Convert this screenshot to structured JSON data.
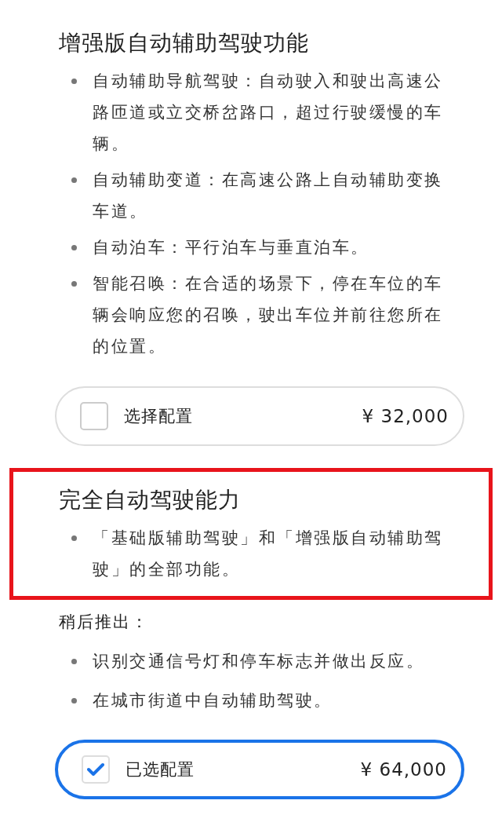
{
  "sections": [
    {
      "title": "增强版自动辅助驾驶功能",
      "highlighted": false,
      "bullets": [
        "自动辅助导航驾驶：自动驶入和驶出高速公路匝道或立交桥岔路口，超过行驶缓慢的车辆。",
        "自动辅助变道：在高速公路上自动辅助变换车道。",
        "自动泊车：平行泊车与垂直泊车。",
        "智能召唤：在合适的场景下，停在车位的车辆会响应您的召唤，驶出车位并前往您所在的位置。"
      ],
      "option": {
        "label": "选择配置",
        "price": "¥ 32,000",
        "selected": false
      }
    },
    {
      "title": "完全自动驾驶能力",
      "highlighted": true,
      "bullets": [
        "「基础版辅助驾驶」和「增强版自动辅助驾驶」的全部功能。"
      ],
      "later_label": "稍后推出：",
      "later_bullets": [
        "识别交通信号灯和停车标志并做出反应。",
        "在城市街道中自动辅助驾驶。"
      ],
      "option": {
        "label": "已选配置",
        "price": "¥ 64,000",
        "selected": true
      }
    }
  ]
}
